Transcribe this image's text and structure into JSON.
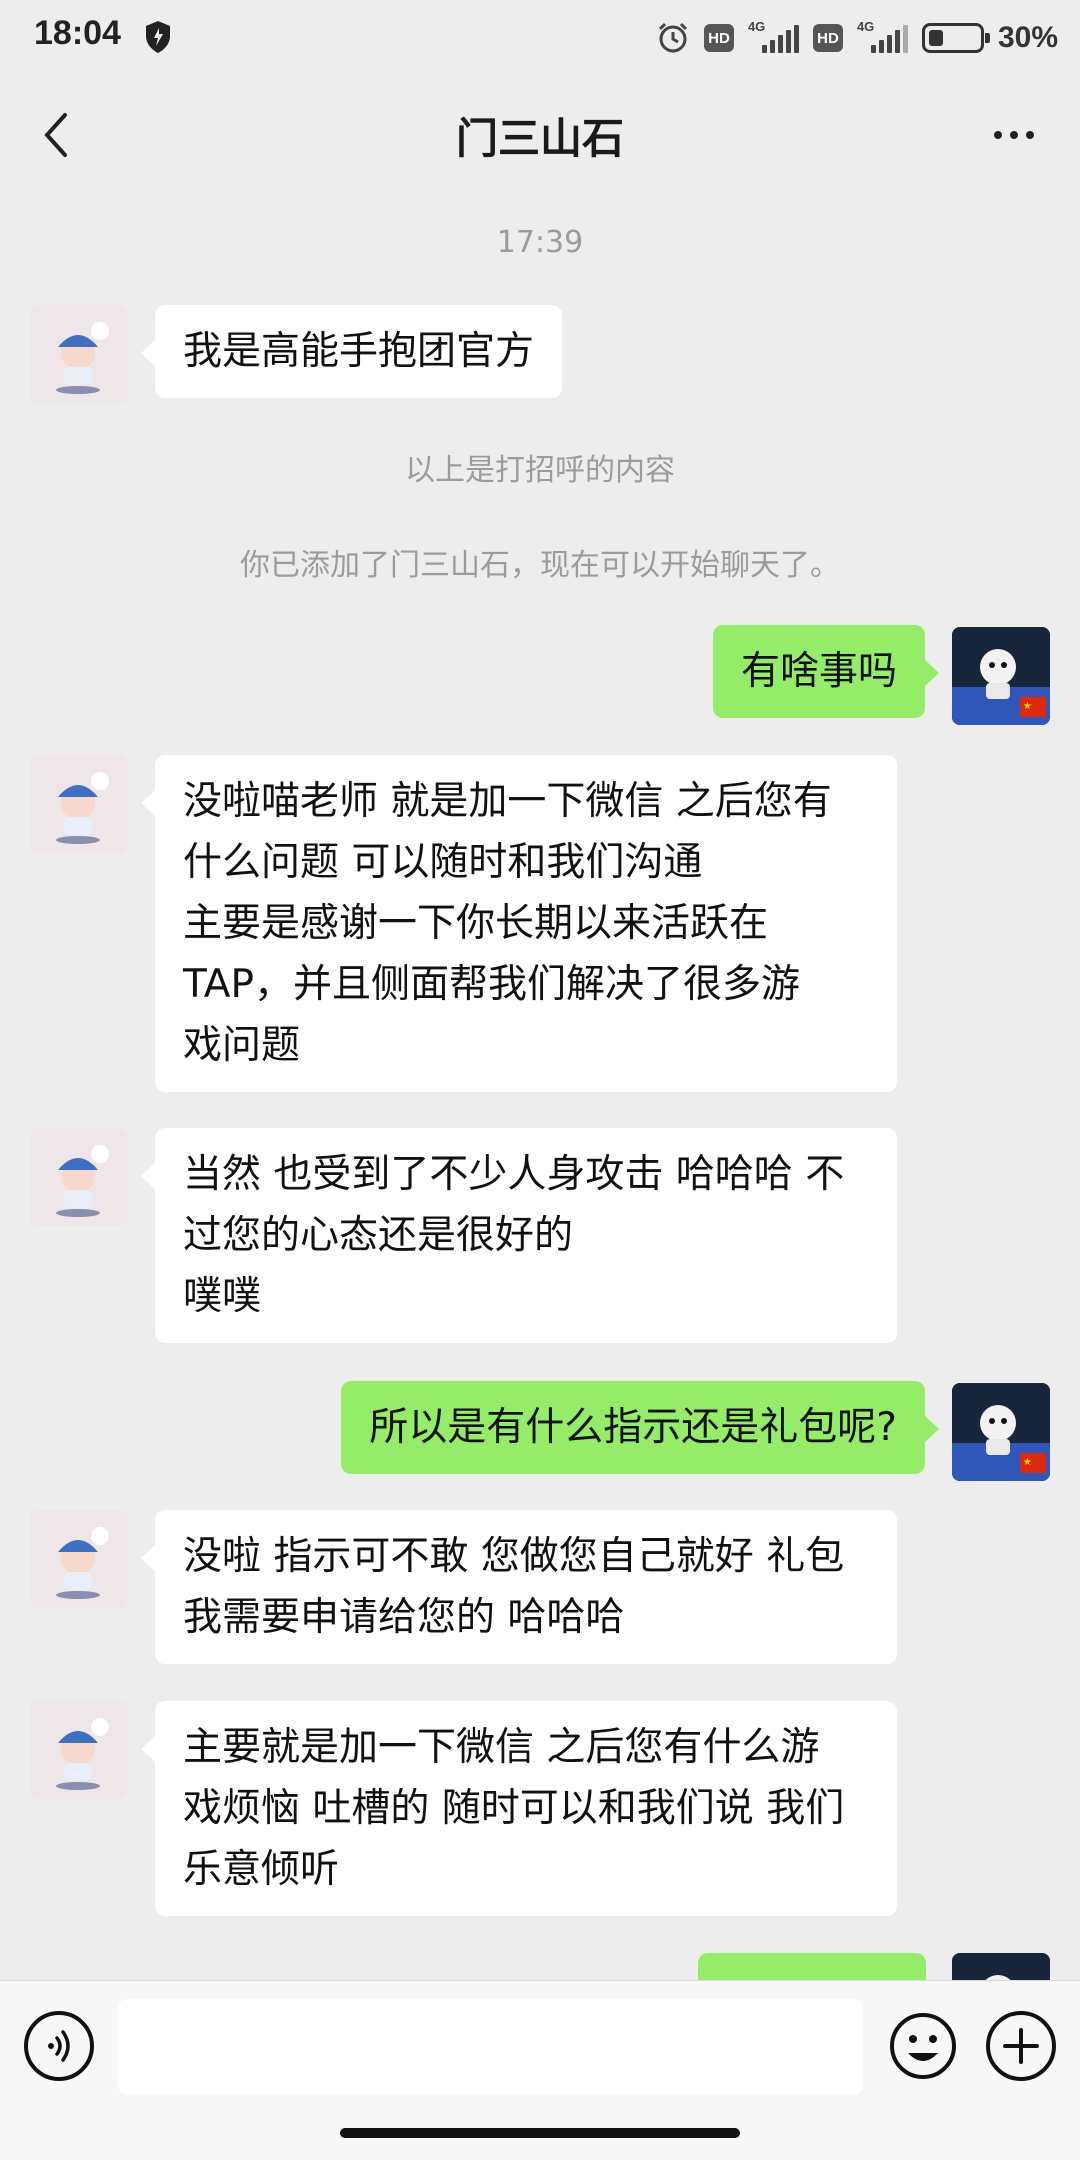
{
  "status_bar": {
    "time": "18:04",
    "hd1": "HD",
    "net1": "4G",
    "hd2": "HD",
    "net2": "4G",
    "battery_percent_text": "30%",
    "battery_level": 0.3
  },
  "nav": {
    "title": "门三山石"
  },
  "chat": {
    "timestamp": "17:39",
    "system_notes": [
      "以上是打招呼的内容",
      "你已添加了门三山石，现在可以开始聊天了。"
    ],
    "messages": [
      {
        "from": "other",
        "text": "我是高能手抱团官方"
      },
      {
        "from": "me",
        "text": "有啥事吗"
      },
      {
        "from": "other",
        "text": "没啦喵老师 就是加一下微信 之后您有\n什么问题 可以随时和我们沟通\n主要是感谢一下你长期以来活跃在\nTAP，并且侧面帮我们解决了很多游\n戏问题"
      },
      {
        "from": "other",
        "text": "当然 也受到了不少人身攻击 哈哈哈 不\n过您的心态还是很好的\n噗噗"
      },
      {
        "from": "me",
        "text": "所以是有什么指示还是礼包呢?"
      },
      {
        "from": "other",
        "text": "没啦 指示可不敢 您做您自己就好 礼包\n我需要申请给您的 哈哈哈"
      },
      {
        "from": "other",
        "text": "主要就是加一下微信 之后您有什么游\n戏烦恼 吐槽的 随时可以和我们说 我们\n乐意倾听"
      }
    ]
  },
  "input_bar": {
    "placeholder": ""
  },
  "colors": {
    "background": "#ededed",
    "my_bubble": "#95ec69",
    "other_bubble": "#ffffff",
    "system_text": "#9b9b9b"
  }
}
